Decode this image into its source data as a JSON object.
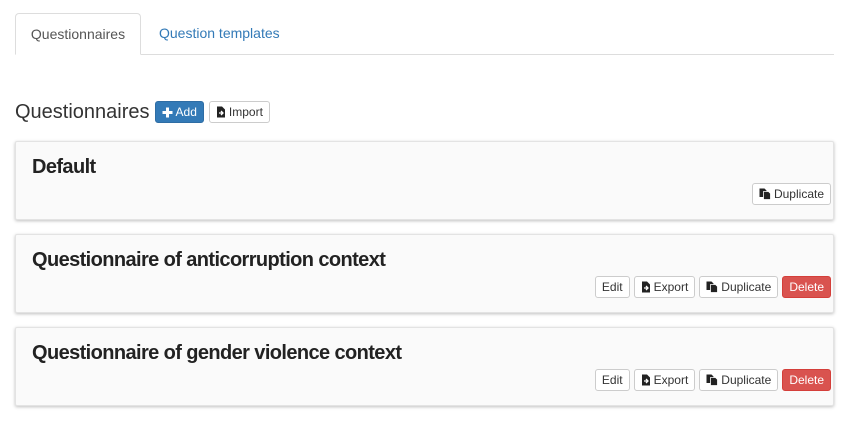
{
  "tabs": [
    {
      "label": "Questionnaires",
      "active": true
    },
    {
      "label": "Question templates",
      "active": false
    }
  ],
  "heading": {
    "title": "Questionnaires",
    "add_label": "Add",
    "import_label": "Import"
  },
  "questionnaires": [
    {
      "title": "Default",
      "actions": {
        "duplicate": "Duplicate"
      }
    },
    {
      "title": "Questionnaire of anticorruption context",
      "actions": {
        "edit": "Edit",
        "export": "Export",
        "duplicate": "Duplicate",
        "delete": "Delete"
      }
    },
    {
      "title": "Questionnaire of gender violence context",
      "actions": {
        "edit": "Edit",
        "export": "Export",
        "duplicate": "Duplicate",
        "delete": "Delete"
      }
    }
  ],
  "icons": {
    "add": "plus-icon",
    "import": "file-import-icon",
    "export": "file-export-icon",
    "duplicate": "copy-icon"
  },
  "colors": {
    "primary": "#337ab7",
    "danger": "#d9534f",
    "link": "#337ab7"
  }
}
